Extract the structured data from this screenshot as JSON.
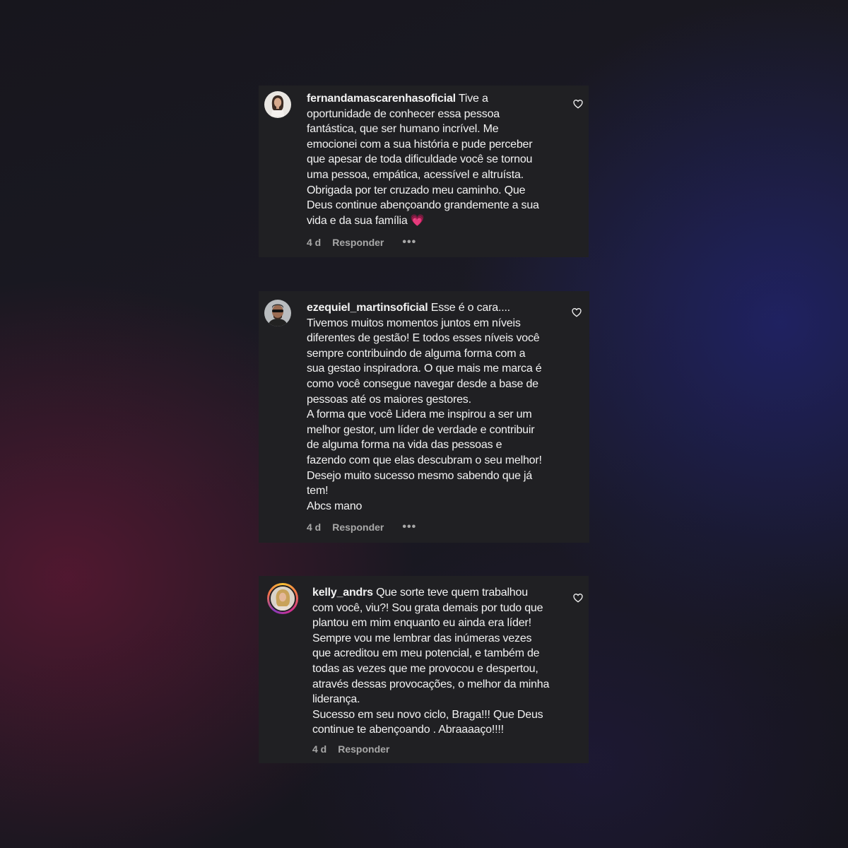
{
  "comments": [
    {
      "username": "fernandamascarenhasoficial",
      "text": "Tive a\noportunidade de conhecer essa pessoa\nfantástica, que ser humano incrível. Me\nemocionei com a sua história e pude perceber\nque apesar de toda dificuldade você se tornou\numa pessoa, empática, acessível e altruísta.\nObrigada por ter cruzado meu caminho. Que\nDeus continue abençoando grandemente a sua\nvida e da sua família",
      "emoji": "💗",
      "time": "4 d",
      "reply": "Responder",
      "more": "•••",
      "avatar": "woman-portrait"
    },
    {
      "username": "ezequiel_martinsoficial",
      "text": "Esse é o cara....\nTivemos muitos momentos juntos em níveis\ndiferentes de gestão! E todos esses níveis você\nsempre contribuindo de alguma forma com a\nsua gestao inspiradora. O que mais me marca é\ncomo você consegue navegar desde a base de\npessoas até os maiores gestores.\nA forma que você Lidera me inspirou a ser um\nmelhor gestor, um líder de verdade e contribuir\nde alguma forma na vida das pessoas e\nfazendo com que elas descubram o seu melhor!\nDesejo muito sucesso mesmo sabendo que já\ntem!\nAbcs mano",
      "time": "4 d",
      "reply": "Responder",
      "more": "•••",
      "avatar": "man-with-sunglasses"
    },
    {
      "username": "kelly_andrs",
      "text": "Que sorte teve quem trabalhou\ncom você, viu?! Sou grata demais por tudo que\nplantou em mim enquanto eu ainda era líder!\nSempre vou me lembrar das inúmeras vezes\nque acreditou em meu potencial, e também de\ntodas as vezes que me provocou e despertou,\natravés dessas provocações, o melhor da minha\nliderança.\nSucesso em seu novo ciclo, Braga!!! Que Deus\ncontinue te abençoando . Abraaaaço!!!!",
      "time": "4 d",
      "reply": "Responder",
      "avatar": "woman-with-story-ring"
    }
  ],
  "icons": {
    "like": "heart-outline-icon"
  },
  "colors": {
    "card": "#202023",
    "text": "#f2f2f2",
    "meta": "#a8a8a8",
    "emoji_heart": "#e83b78"
  }
}
